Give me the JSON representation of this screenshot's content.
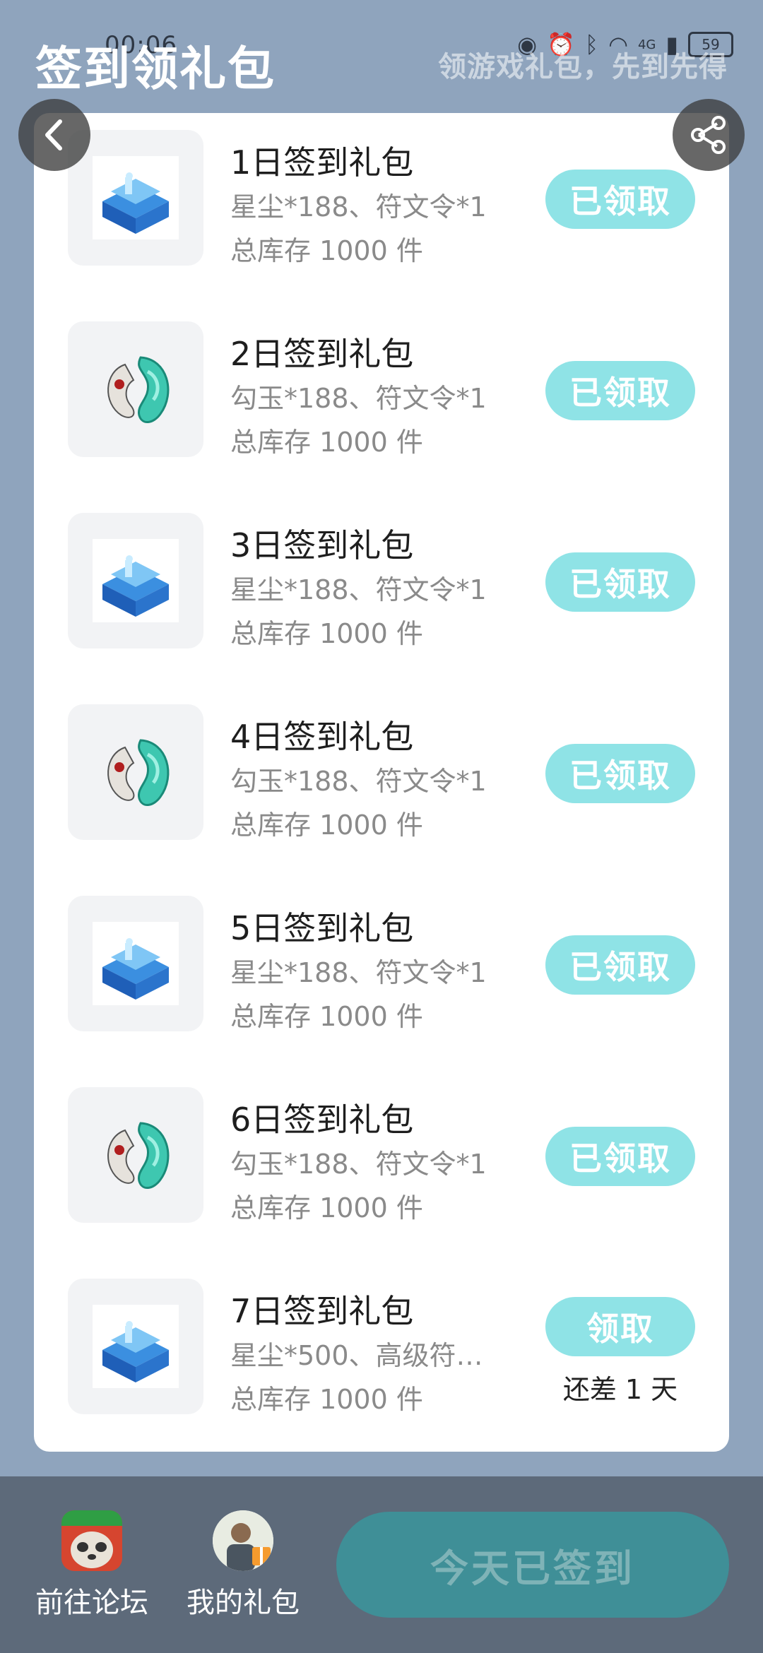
{
  "status_bar": {
    "time": "00:06",
    "network": "4G",
    "battery": "59"
  },
  "header": {
    "title": "签到领礼包",
    "slogan": "领游戏礼包，先到先得"
  },
  "gifts": [
    {
      "name": "1日签到礼包",
      "content": "星尘*188、符文令*1",
      "stock": "总库存 1000 件",
      "button": "已领取",
      "icon": "blue-chest-icon"
    },
    {
      "name": "2日签到礼包",
      "content": "勾玉*188、符文令*1",
      "stock": "总库存 1000 件",
      "button": "已领取",
      "icon": "jade-magatama-icon"
    },
    {
      "name": "3日签到礼包",
      "content": "星尘*188、符文令*1",
      "stock": "总库存 1000 件",
      "button": "已领取",
      "icon": "blue-chest-icon"
    },
    {
      "name": "4日签到礼包",
      "content": "勾玉*188、符文令*1",
      "stock": "总库存 1000 件",
      "button": "已领取",
      "icon": "jade-magatama-icon"
    },
    {
      "name": "5日签到礼包",
      "content": "星尘*188、符文令*1",
      "stock": "总库存 1000 件",
      "button": "已领取",
      "icon": "blue-chest-icon"
    },
    {
      "name": "6日签到礼包",
      "content": "勾玉*188、符文令*1",
      "stock": "总库存 1000 件",
      "button": "已领取",
      "icon": "jade-magatama-icon"
    },
    {
      "name": "7日签到礼包",
      "content": "星尘*500、高级符…",
      "stock": "总库存 1000 件",
      "button": "领取",
      "note": "还差 1 天",
      "icon": "blue-chest-icon"
    }
  ],
  "bottom_bar": {
    "forum_label": "前往论坛",
    "my_gifts_label": "我的礼包",
    "signed_label": "今天已签到"
  },
  "colors": {
    "background": "#8fa4bd",
    "claim_button": "#8fe3e6",
    "signed_button": "#3f8f97"
  }
}
